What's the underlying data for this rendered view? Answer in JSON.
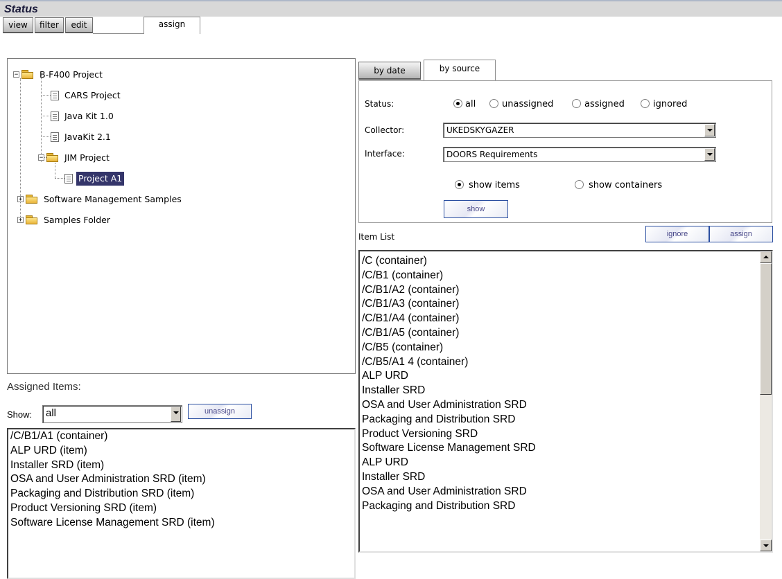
{
  "header": {
    "title": "Status"
  },
  "tabs": [
    {
      "label": "view"
    },
    {
      "label": "filter"
    },
    {
      "label": "edit"
    },
    {
      "label": "assign",
      "active": true
    }
  ],
  "tree": {
    "nodes": [
      {
        "label": "B-F400 Project",
        "kind": "folder",
        "expanded": true
      },
      {
        "label": "CARS Project",
        "kind": "document"
      },
      {
        "label": "Java Kit 1.0",
        "kind": "document"
      },
      {
        "label": "JavaKit 2.1",
        "kind": "document"
      },
      {
        "label": "JIM Project",
        "kind": "folder",
        "expanded": true
      },
      {
        "label": "Project A1",
        "kind": "document",
        "selected": true
      },
      {
        "label": "Software Management Samples",
        "kind": "folder",
        "expanded": false
      },
      {
        "label": "Samples Folder",
        "kind": "folder",
        "expanded": false
      }
    ]
  },
  "assigned": {
    "heading": "Assigned Items:",
    "show_label": "Show:",
    "show_value": "all",
    "unassign_label": "unassign",
    "items": [
      "/C/B1/A1 (container)",
      "ALP URD (item)",
      "Installer SRD (item)",
      "OSA and User Administration SRD (item)",
      "Packaging and Distribution SRD (item)",
      "Product Versioning SRD (item)",
      "Software License Management SRD (item)"
    ]
  },
  "source_tabs": [
    {
      "label": "by date"
    },
    {
      "label": "by source",
      "active": true
    }
  ],
  "filters": {
    "status_label": "Status:",
    "status_options": [
      "all",
      "unassigned",
      "assigned",
      "ignored"
    ],
    "status_selected": "all",
    "collector_label": "Collector:",
    "collector_value": "UKEDSKYGAZER",
    "interface_label": "Interface:",
    "interface_value": "DOORS Requirements",
    "view_options": [
      "show items",
      "show containers"
    ],
    "view_selected": "show items",
    "show_button": "show"
  },
  "item_list": {
    "label": "Item List",
    "ignore_button": "ignore",
    "assign_button": "assign",
    "items": [
      "/C (container)",
      "/C/B1 (container)",
      "/C/B1/A2 (container)",
      "/C/B1/A3 (container)",
      "/C/B1/A4 (container)",
      "/C/B1/A5 (container)",
      "/C/B5 (container)",
      "/C/B5/A1 4 (container)",
      "ALP URD",
      "Installer SRD",
      "OSA and User Administration SRD",
      "Packaging and Distribution SRD",
      "Product Versioning SRD",
      "Software License Management SRD",
      "ALP URD",
      "Installer SRD",
      "OSA and User Administration SRD",
      "Packaging and Distribution SRD"
    ]
  }
}
